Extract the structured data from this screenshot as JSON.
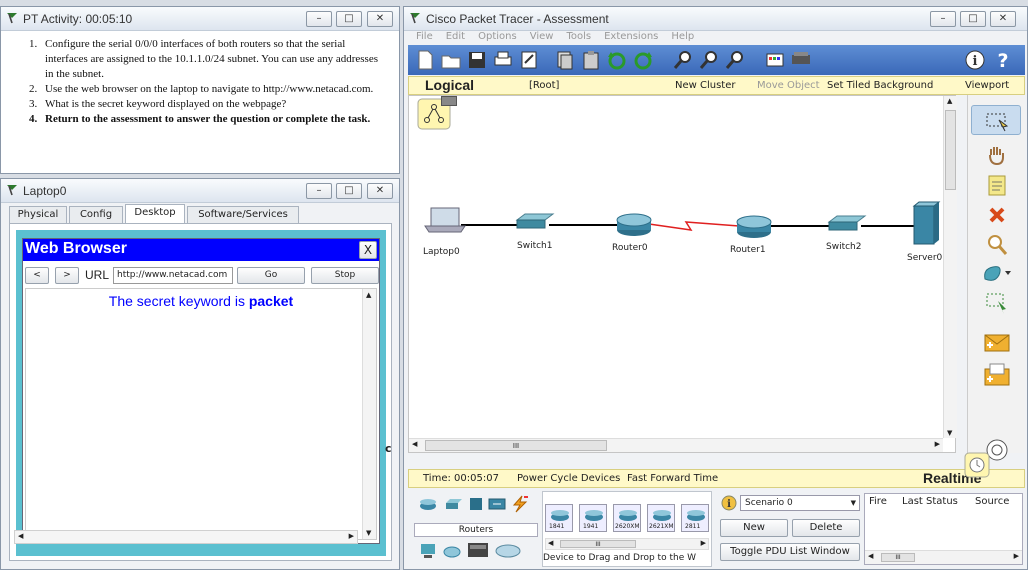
{
  "pt_activity": {
    "title": "PT Activity: 00:05:10",
    "instructions": [
      {
        "num": "1.",
        "text": "Configure the serial 0/0/0 interfaces of both routers so that the serial interfaces are assigned to the 10.1.1.0/24 subnet. You can use any addresses in the subnet.",
        "bold": false
      },
      {
        "num": "2.",
        "text": "Use the web browser on the laptop to navigate to http://www.netacad.com.",
        "bold": false
      },
      {
        "num": "3.",
        "text": "What is the secret keyword displayed on the webpage?",
        "bold": false
      },
      {
        "num": "4.",
        "text": "Return to the assessment to answer the question or complete the task.",
        "bold": true
      }
    ]
  },
  "laptop": {
    "title": "Laptop0",
    "tabs": [
      "Physical",
      "Config",
      "Desktop",
      "Software/Services"
    ],
    "active_tab": "Desktop",
    "browser": {
      "title": "Web Browser",
      "close": "X",
      "back": "<",
      "forward": ">",
      "url_label": "URL",
      "url": "http://www.netacad.com",
      "go": "Go",
      "stop": "Stop",
      "content_prefix": "The secret keyword is ",
      "keyword": "packet"
    },
    "side_char": "c"
  },
  "cpt": {
    "title": "Cisco Packet Tracer - Assessment",
    "menu": [
      "File",
      "Edit",
      "Options",
      "View",
      "Tools",
      "Extensions",
      "Help"
    ],
    "bar": {
      "logical": "Logical",
      "root": "[Root]",
      "new_cluster": "New Cluster",
      "move_object": "Move Object",
      "set_bg": "Set Tiled Background",
      "viewport": "Viewport"
    },
    "devices": [
      {
        "id": "laptop0",
        "label": "Laptop0"
      },
      {
        "id": "switch1",
        "label": "Switch1"
      },
      {
        "id": "router0",
        "label": "Router0"
      },
      {
        "id": "router1",
        "label": "Router1"
      },
      {
        "id": "switch2",
        "label": "Switch2"
      },
      {
        "id": "server0",
        "label": "Server0"
      }
    ],
    "scroll_mid": "III",
    "time": "Time: 00:05:07",
    "power_cycle": "Power Cycle Devices",
    "fast_forward": "Fast Forward Time",
    "realtime": "Realtime",
    "category": "Routers",
    "models": [
      "1841",
      "1941",
      "2620XM",
      "2621XM",
      "2811"
    ],
    "drag_hint": "Device to Drag and Drop to the W",
    "scenario": "Scenario 0",
    "new": "New",
    "delete": "Delete",
    "toggle_pdu": "Toggle PDU List Window",
    "pdu_cols": [
      "Fire",
      "Last Status",
      "Source"
    ]
  },
  "colors": {
    "title_blue": "#0000ff",
    "link_red": "#e02020",
    "teal": "#5bc0d0"
  }
}
